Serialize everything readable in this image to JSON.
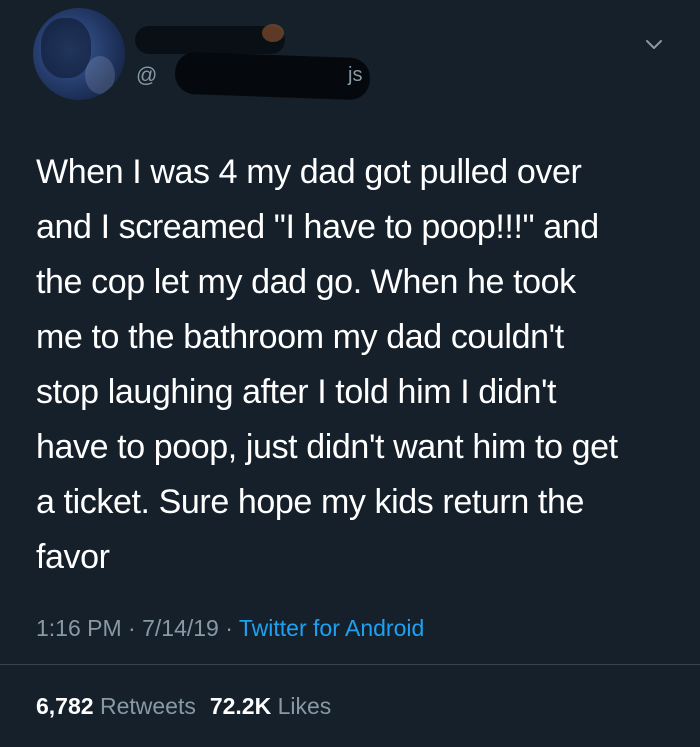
{
  "tweet": {
    "handle_prefix": "@",
    "handle_suffix": "js",
    "text": "When I was 4 my dad got pulled over\nand I screamed \"I have to poop!!!\" and\nthe cop let my dad go. When he took\nme to the bathroom my dad couldn't\nstop laughing after I told him I didn't\nhave to poop, just didn't want him to get\na ticket. Sure hope my kids return the\nfavor",
    "time": "1:16 PM",
    "date": "7/14/19",
    "separator": "·",
    "source": "Twitter for Android",
    "retweets_count": "6,782",
    "retweets_label": "Retweets",
    "likes_count": "72.2K",
    "likes_label": "Likes"
  },
  "icons": {
    "chevron": "chevron-down-icon"
  },
  "colors": {
    "background": "#15202b",
    "text": "#ffffff",
    "muted": "#8899a6",
    "link": "#1da1f2",
    "divider": "#38444d"
  }
}
